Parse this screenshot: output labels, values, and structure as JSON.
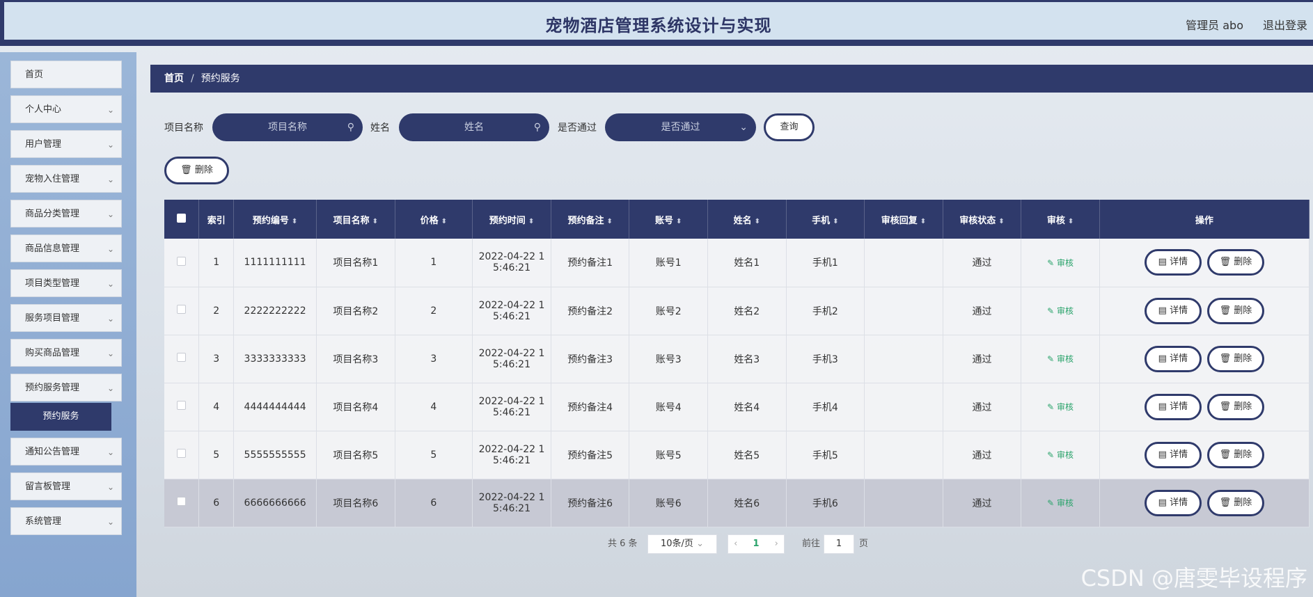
{
  "header": {
    "title": "宠物酒店管理系统设计与实现",
    "user": "管理员 abo",
    "logout": "退出登录"
  },
  "sidebar": {
    "items": [
      {
        "label": "首页"
      },
      {
        "label": "个人中心"
      },
      {
        "label": "用户管理"
      },
      {
        "label": "宠物入住管理"
      },
      {
        "label": "商品分类管理"
      },
      {
        "label": "商品信息管理"
      },
      {
        "label": "项目类型管理"
      },
      {
        "label": "服务项目管理"
      },
      {
        "label": "购买商品管理"
      },
      {
        "label": "预约服务管理"
      },
      {
        "label": "通知公告管理"
      },
      {
        "label": "留言板管理"
      },
      {
        "label": "系统管理"
      }
    ],
    "active_sub": "预约服务"
  },
  "breadcrumb": {
    "home": "首页",
    "separator": "/",
    "current": "预约服务"
  },
  "filters": {
    "project_label": "项目名称",
    "project_placeholder": "项目名称",
    "name_label": "姓名",
    "name_placeholder": "姓名",
    "pass_label": "是否通过",
    "pass_placeholder": "是否通过",
    "query_button": "查询"
  },
  "toolbar": {
    "delete_button": "删除"
  },
  "table": {
    "headers": [
      "索引",
      "预约编号",
      "项目名称",
      "价格",
      "预约时间",
      "预约备注",
      "账号",
      "姓名",
      "手机",
      "审核回复",
      "审核状态",
      "审核",
      "操作"
    ],
    "audit_label": "审核",
    "detail_label": "详情",
    "delete_label": "删除",
    "rows": [
      {
        "idx": "1",
        "no": "1111111111",
        "project": "项目名称1",
        "price": "1",
        "time1": "2022-04-22 1",
        "time2": "5:46:21",
        "note": "预约备注1",
        "account": "账号1",
        "name": "姓名1",
        "phone": "手机1",
        "reply": "",
        "status": "通过"
      },
      {
        "idx": "2",
        "no": "2222222222",
        "project": "项目名称2",
        "price": "2",
        "time1": "2022-04-22 1",
        "time2": "5:46:21",
        "note": "预约备注2",
        "account": "账号2",
        "name": "姓名2",
        "phone": "手机2",
        "reply": "",
        "status": "通过"
      },
      {
        "idx": "3",
        "no": "3333333333",
        "project": "项目名称3",
        "price": "3",
        "time1": "2022-04-22 1",
        "time2": "5:46:21",
        "note": "预约备注3",
        "account": "账号3",
        "name": "姓名3",
        "phone": "手机3",
        "reply": "",
        "status": "通过"
      },
      {
        "idx": "4",
        "no": "4444444444",
        "project": "项目名称4",
        "price": "4",
        "time1": "2022-04-22 1",
        "time2": "5:46:21",
        "note": "预约备注4",
        "account": "账号4",
        "name": "姓名4",
        "phone": "手机4",
        "reply": "",
        "status": "通过"
      },
      {
        "idx": "5",
        "no": "5555555555",
        "project": "项目名称5",
        "price": "5",
        "time1": "2022-04-22 1",
        "time2": "5:46:21",
        "note": "预约备注5",
        "account": "账号5",
        "name": "姓名5",
        "phone": "手机5",
        "reply": "",
        "status": "通过"
      },
      {
        "idx": "6",
        "no": "6666666666",
        "project": "项目名称6",
        "price": "6",
        "time1": "2022-04-22 1",
        "time2": "5:46:21",
        "note": "预约备注6",
        "account": "账号6",
        "name": "姓名6",
        "phone": "手机6",
        "reply": "",
        "status": "通过"
      }
    ]
  },
  "pagination": {
    "total": "共 6 条",
    "page_size": "10条/页",
    "current_page": "1",
    "goto_label": "前往",
    "goto_value": "1",
    "page_suffix": "页"
  },
  "watermark": "CSDN @唐雯毕设程序"
}
